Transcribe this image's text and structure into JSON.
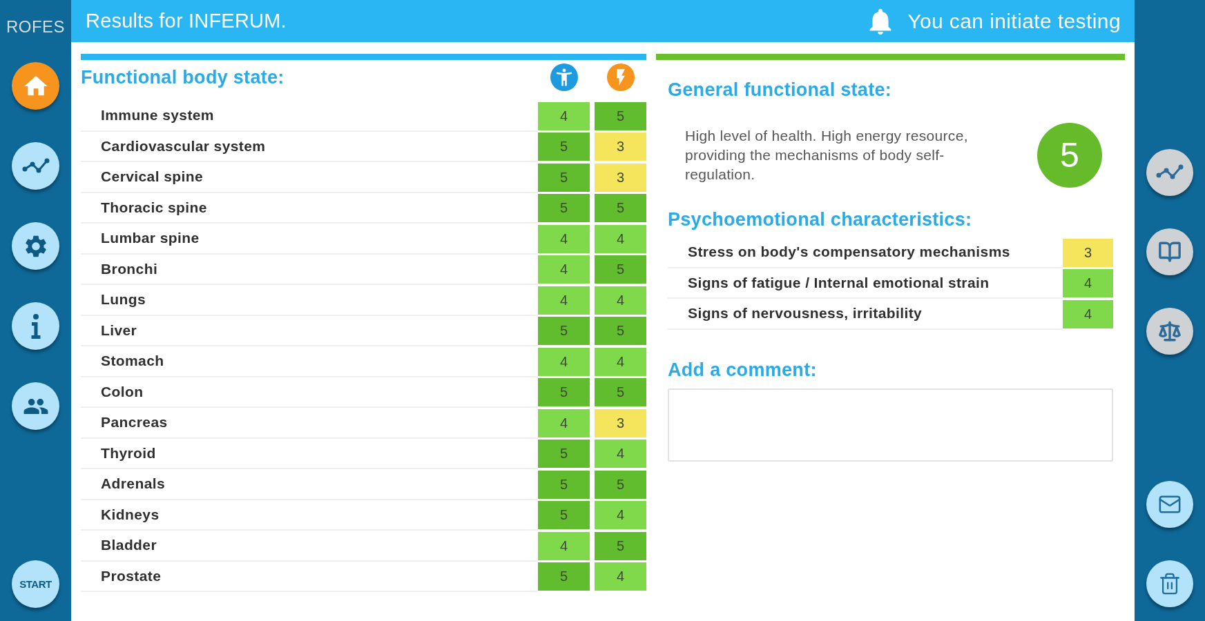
{
  "sidebar": {
    "logo": "ROFES",
    "items": [
      {
        "selected": true
      },
      {
        "selected": false
      },
      {
        "selected": false
      },
      {
        "selected": false
      },
      {
        "selected": false
      }
    ],
    "start_button": "START"
  },
  "header": {
    "title": "Results for INFERUM.",
    "notice": "You can initiate testing"
  },
  "body_state": {
    "title": "Functional body state:",
    "rows": [
      {
        "name": "Immune system",
        "scores": [
          {
            "value": "4",
            "color": "#80d94a"
          },
          {
            "value": "5",
            "color": "#62bd2e"
          }
        ]
      },
      {
        "name": "Cardiovascular system",
        "scores": [
          {
            "value": "5",
            "color": "#62bd2e"
          },
          {
            "value": "3",
            "color": "#f5e55c"
          }
        ]
      },
      {
        "name": "Cervical spine",
        "scores": [
          {
            "value": "5",
            "color": "#62bd2e"
          },
          {
            "value": "3",
            "color": "#f5e55c"
          }
        ]
      },
      {
        "name": "Thoracic spine",
        "scores": [
          {
            "value": "5",
            "color": "#62bd2e"
          },
          {
            "value": "5",
            "color": "#62bd2e"
          }
        ]
      },
      {
        "name": "Lumbar spine",
        "scores": [
          {
            "value": "4",
            "color": "#80d94a"
          },
          {
            "value": "4",
            "color": "#80d94a"
          }
        ]
      },
      {
        "name": "Bronchi",
        "scores": [
          {
            "value": "4",
            "color": "#80d94a"
          },
          {
            "value": "5",
            "color": "#62bd2e"
          }
        ]
      },
      {
        "name": "Lungs",
        "scores": [
          {
            "value": "4",
            "color": "#80d94a"
          },
          {
            "value": "4",
            "color": "#80d94a"
          }
        ]
      },
      {
        "name": "Liver",
        "scores": [
          {
            "value": "5",
            "color": "#62bd2e"
          },
          {
            "value": "5",
            "color": "#62bd2e"
          }
        ]
      },
      {
        "name": "Stomach",
        "scores": [
          {
            "value": "4",
            "color": "#80d94a"
          },
          {
            "value": "4",
            "color": "#80d94a"
          }
        ]
      },
      {
        "name": "Colon",
        "scores": [
          {
            "value": "5",
            "color": "#62bd2e"
          },
          {
            "value": "5",
            "color": "#62bd2e"
          }
        ]
      },
      {
        "name": "Pancreas",
        "scores": [
          {
            "value": "4",
            "color": "#80d94a"
          },
          {
            "value": "3",
            "color": "#f5e55c"
          }
        ]
      },
      {
        "name": "Thyroid",
        "scores": [
          {
            "value": "5",
            "color": "#62bd2e"
          },
          {
            "value": "4",
            "color": "#80d94a"
          }
        ]
      },
      {
        "name": "Adrenals",
        "scores": [
          {
            "value": "5",
            "color": "#62bd2e"
          },
          {
            "value": "5",
            "color": "#62bd2e"
          }
        ]
      },
      {
        "name": "Kidneys",
        "scores": [
          {
            "value": "5",
            "color": "#62bd2e"
          },
          {
            "value": "4",
            "color": "#80d94a"
          }
        ]
      },
      {
        "name": "Bladder",
        "scores": [
          {
            "value": "4",
            "color": "#80d94a"
          },
          {
            "value": "5",
            "color": "#62bd2e"
          }
        ]
      },
      {
        "name": "Prostate",
        "scores": [
          {
            "value": "5",
            "color": "#62bd2e"
          },
          {
            "value": "4",
            "color": "#80d94a"
          }
        ]
      }
    ]
  },
  "general_state": {
    "title": "General functional state:",
    "description": "High level of health. High energy resource, providing the mechanisms of body self-regulation.",
    "score": {
      "value": "5",
      "color": "#66bb2a"
    }
  },
  "psychoemotional": {
    "title": "Psychoemotional characteristics:",
    "rows": [
      {
        "name": "Stress on body's compensatory mechanisms",
        "score": {
          "value": "3",
          "color": "#f5e55c"
        }
      },
      {
        "name": "Signs of fatigue / Internal emotional strain",
        "score": {
          "value": "4",
          "color": "#80d94a"
        }
      },
      {
        "name": "Signs of nervousness, irritability",
        "score": {
          "value": "4",
          "color": "#80d94a"
        }
      }
    ]
  },
  "comment": {
    "title": "Add a comment:"
  },
  "toolbar": {
    "items": [
      {
        "disabled": true
      },
      {
        "disabled": true
      },
      {
        "disabled": true
      },
      {
        "disabled": false
      },
      {
        "disabled": false
      }
    ]
  }
}
